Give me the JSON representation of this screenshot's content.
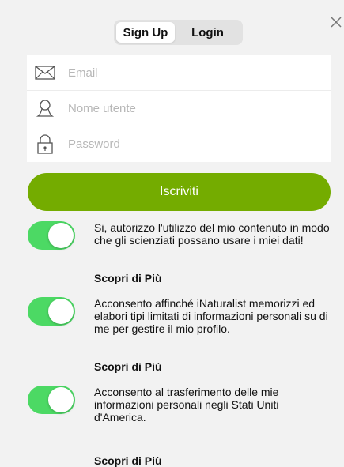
{
  "tabs": {
    "signup": "Sign Up",
    "login": "Login"
  },
  "form": {
    "email_placeholder": "Email",
    "username_placeholder": "Nome utente",
    "password_placeholder": "Password"
  },
  "submit_label": "Iscriviti",
  "consents": [
    {
      "text": "Si, autorizzo l'utilizzo del mio contenuto in modo che gli scienziati possano usare i miei dati!",
      "more": "Scopri di Più",
      "enabled": true
    },
    {
      "text": "Acconsento affinché iNaturalist memorizzi ed elabori tipi limitati di informazioni personali su di me per gestire il mio profilo.",
      "more": "Scopri di Più",
      "enabled": true
    },
    {
      "text": "Acconsento al trasferimento delle mie informazioni personali negli Stati Uniti d'America.",
      "more": "Scopri di Più",
      "enabled": true
    }
  ],
  "colors": {
    "accent": "#74ac00",
    "toggle_on": "#4cd964"
  }
}
